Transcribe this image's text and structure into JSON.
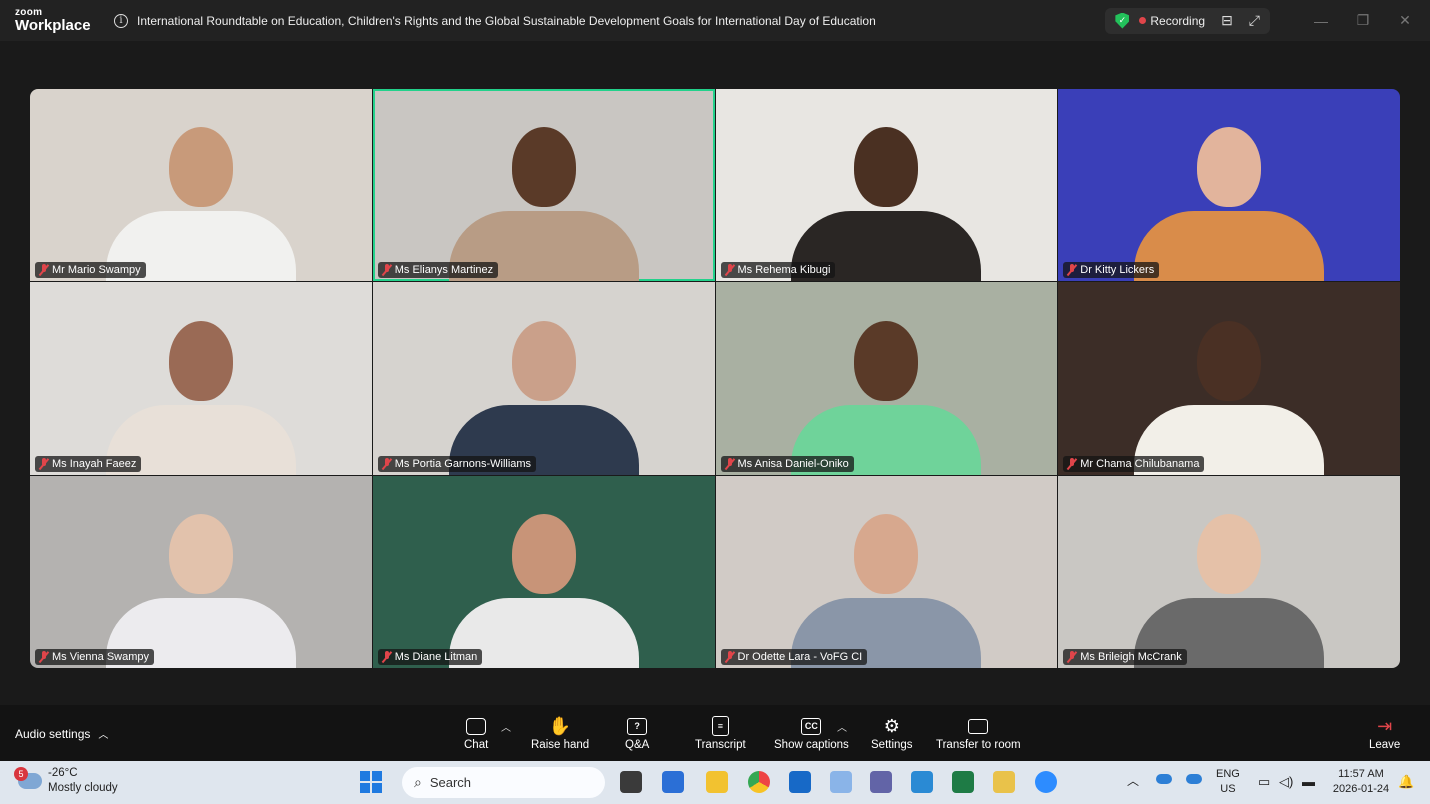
{
  "app": {
    "brand_top": "zoom",
    "brand_bottom": "Workplace"
  },
  "meeting": {
    "title": "International Roundtable on Education, Children's Rights and the Global Sustainable Development Goals for International Day of Education"
  },
  "status": {
    "recording_label": "Recording"
  },
  "participants": [
    {
      "name": "Mr Mario Swampy",
      "bg": "#d9d3cc",
      "skin": "#c89a7a",
      "shirt": "#f1f1ef"
    },
    {
      "name": "Ms Elianys Martinez",
      "bg": "#c9c6c2",
      "skin": "#5a3a28",
      "shirt": "#b89c85",
      "active": true
    },
    {
      "name": "Ms Rehema Kibugi",
      "bg": "#e8e6e2",
      "skin": "#4a3022",
      "shirt": "#2a2624"
    },
    {
      "name": "Dr Kitty Lickers",
      "bg": "#3a3fb8",
      "skin": "#e2b49c",
      "shirt": "#d98c4a"
    },
    {
      "name": "Ms Inayah Faeez",
      "bg": "#dedcd9",
      "skin": "#9a6a55",
      "shirt": "#e8e0d8"
    },
    {
      "name": "Ms Portia Garnons-Williams",
      "bg": "#d6d3cf",
      "skin": "#caa08a",
      "shirt": "#2e3a4e"
    },
    {
      "name": "Ms Anisa Daniel-Oniko",
      "bg": "#a9b0a2",
      "skin": "#5a3a28",
      "shirt": "#6fd39a"
    },
    {
      "name": "Mr Chama Chilubanama",
      "bg": "#3c2d27",
      "skin": "#4a3024",
      "shirt": "#f2efe8"
    },
    {
      "name": "Ms Vienna Swampy",
      "bg": "#b4b2b0",
      "skin": "#e2c2ac",
      "shirt": "#ecebee"
    },
    {
      "name": "Ms Diane Litman",
      "bg": "#2f5f4d",
      "skin": "#c89478",
      "shirt": "#e9e9e9"
    },
    {
      "name": "Dr Odette Lara - VoFG CI",
      "bg": "#d1cbc6",
      "skin": "#d7a88e",
      "shirt": "#8a96a8"
    },
    {
      "name": "Ms Brileigh McCrank",
      "bg": "#c9c7c3",
      "skin": "#e5c1a8",
      "shirt": "#6a6a6a"
    }
  ],
  "toolbar": {
    "audio_settings": "Audio settings",
    "chat": "Chat",
    "raise_hand": "Raise hand",
    "qa": "Q&A",
    "transcript": "Transcript",
    "show_captions": "Show captions",
    "settings": "Settings",
    "transfer": "Transfer to room",
    "leave": "Leave"
  },
  "taskbar": {
    "weather_badge": "5",
    "temperature": "-26°C",
    "condition": "Mostly cloudy",
    "search_placeholder": "Search",
    "lang_top": "ENG",
    "lang_bottom": "US",
    "time": "11:57 AM",
    "date": "2026-01-24"
  },
  "colors": {
    "active_speaker": "#23d18b",
    "muted": "#e0454a",
    "shield": "#23c15b",
    "accent": "#1f7ae0"
  }
}
